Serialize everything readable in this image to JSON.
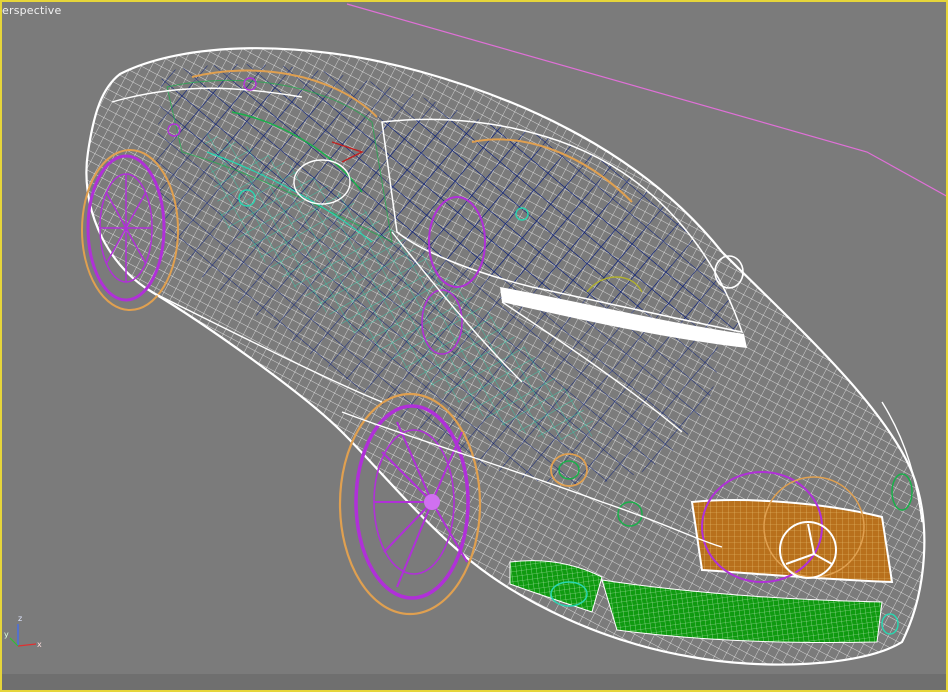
{
  "viewport": {
    "label": "erspective",
    "border_color": "#e6d53a",
    "background": "#7b7b7b",
    "axis": {
      "x": "x",
      "y": "y",
      "z": "z"
    }
  },
  "colors": {
    "wire_white": "#ffffff",
    "wire_navy": "#0b1f7a",
    "wire_green": "#19b04a",
    "wire_teal": "#2ad6b0",
    "wire_magenta": "#b030d8",
    "wire_orange": "#e0a050",
    "solid_green": "#0f9a10",
    "grille_orange": "#c07a1e",
    "pink_line": "#e070d8"
  }
}
